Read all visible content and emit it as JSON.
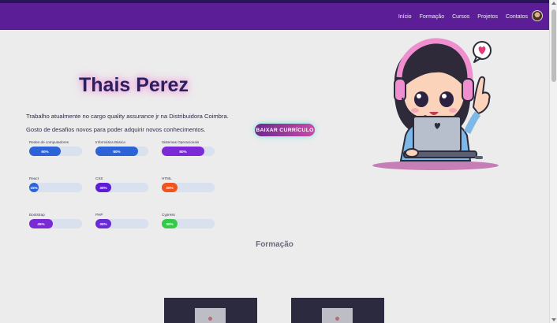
{
  "nav": {
    "links": [
      "Início",
      "Formação",
      "Cursos",
      "Projetos",
      "Contatos"
    ]
  },
  "hero": {
    "name": "Thais Perez",
    "bio_line1": "Trabalho atualmente no cargo quality assurance jr na Distribuidora Coimbra.",
    "bio_line2": "Gosto de desafios novos para poder adquirir novos conhecimentos.",
    "cv_button": "BAIXAR CURRÍCULO"
  },
  "skills": [
    {
      "name": "Redes de computadores",
      "label": "60%",
      "value": 0.6,
      "color": "#2c63d6"
    },
    {
      "name": "Informática Básica",
      "label": "80%",
      "value": 0.8,
      "color": "#2c63d6"
    },
    {
      "name": "Sistemas Operacionais",
      "label": "80%",
      "value": 0.8,
      "color": "#7a2bd6"
    },
    {
      "name": "React",
      "label": "15%",
      "value": 0.15,
      "color": "#2c63d6"
    },
    {
      "name": "CSS",
      "label": "30%",
      "value": 0.3,
      "color": "#5b1ed6"
    },
    {
      "name": "HTML",
      "label": "30%",
      "value": 0.3,
      "color": "#f0541e"
    },
    {
      "name": "Bootstrap",
      "label": "45%",
      "value": 0.45,
      "color": "#7a2bd6"
    },
    {
      "name": "PHP",
      "label": "30%",
      "value": 0.3,
      "color": "#6a2bd6"
    },
    {
      "name": "Cypress",
      "label": "30%",
      "value": 0.3,
      "color": "#35c94a"
    }
  ],
  "sections": {
    "formacao_title": "Formação"
  },
  "colors": {
    "navbar": "#5b1e97",
    "title_glow": "#ec8fd4",
    "button_gradient_start": "#6a2a8c",
    "button_gradient_end": "#c94aa8"
  },
  "icons": {
    "avatar": "profile-photo",
    "illustration": "girl-with-headset-laptop",
    "heart": "heart-speech-bubble"
  }
}
